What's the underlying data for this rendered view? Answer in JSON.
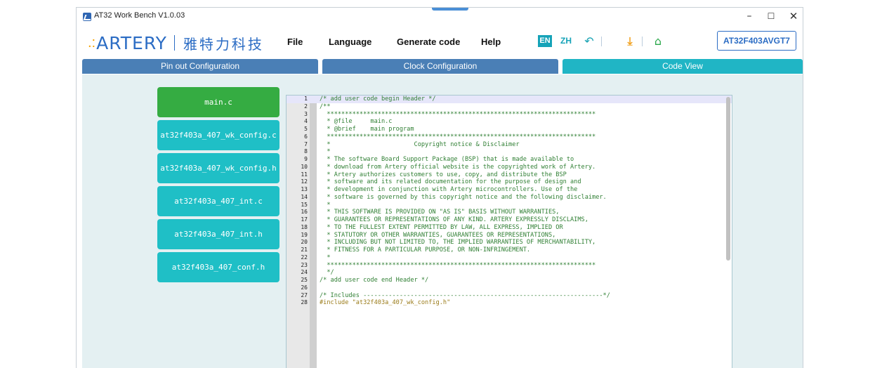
{
  "window": {
    "title": "AT32 Work Bench V1.0.03"
  },
  "header": {
    "logo_text": "ARTERY",
    "logo_chinese": "雅特力科技",
    "menu": {
      "file": "File",
      "language": "Language",
      "generate": "Generate code",
      "help": "Help"
    },
    "lang_en": "EN",
    "lang_zh": "ZH",
    "chip": "AT32F403AVGT7"
  },
  "tabs": {
    "pinout": "Pin out  Configuration",
    "clock": "Clock Configuration",
    "code": "Code View"
  },
  "files": [
    "main.c",
    "at32f403a_407_wk_config.c",
    "at32f403a_407_wk_config.h",
    "at32f403a_407_int.c",
    "at32f403a_407_int.h",
    "at32f403a_407_conf.h"
  ],
  "active_file": "main.c",
  "code_lines": [
    "/* add user code begin Header */",
    "/**",
    "  **************************************************************************",
    "  * @file     main.c",
    "  * @brief    main program",
    "  **************************************************************************",
    "  *                       Copyright notice & Disclaimer",
    "  *",
    "  * The software Board Support Package (BSP) that is made available to",
    "  * download from Artery official website is the copyrighted work of Artery.",
    "  * Artery authorizes customers to use, copy, and distribute the BSP",
    "  * software and its related documentation for the purpose of design and",
    "  * development in conjunction with Artery microcontrollers. Use of the",
    "  * software is governed by this copyright notice and the following disclaimer.",
    "  *",
    "  * THIS SOFTWARE IS PROVIDED ON \"AS IS\" BASIS WITHOUT WARRANTIES,",
    "  * GUARANTEES OR REPRESENTATIONS OF ANY KIND. ARTERY EXPRESSLY DISCLAIMS,",
    "  * TO THE FULLEST EXTENT PERMITTED BY LAW, ALL EXPRESS, IMPLIED OR",
    "  * STATUTORY OR OTHER WARRANTIES, GUARANTEES OR REPRESENTATIONS,",
    "  * INCLUDING BUT NOT LIMITED TO, THE IMPLIED WARRANTIES OF MERCHANTABILITY,",
    "  * FITNESS FOR A PARTICULAR PURPOSE, OR NON-INFRINGEMENT.",
    "  *",
    "  **************************************************************************",
    "  */",
    "/* add user code end Header */",
    "",
    "/* Includes ------------------------------------------------------------------*/",
    "#include \"at32f403a_407_wk_config.h\""
  ],
  "colors": {
    "tab_blue": "#4a7fb6",
    "tab_teal": "#20b5c5",
    "file_teal": "#1fbfc6",
    "file_active": "#35ac42",
    "brand_blue": "#2b6cc4",
    "comment_green": "#2f7f33"
  },
  "icons": {
    "undo": "undo-icon",
    "download": "download-icon",
    "home": "home-icon"
  }
}
